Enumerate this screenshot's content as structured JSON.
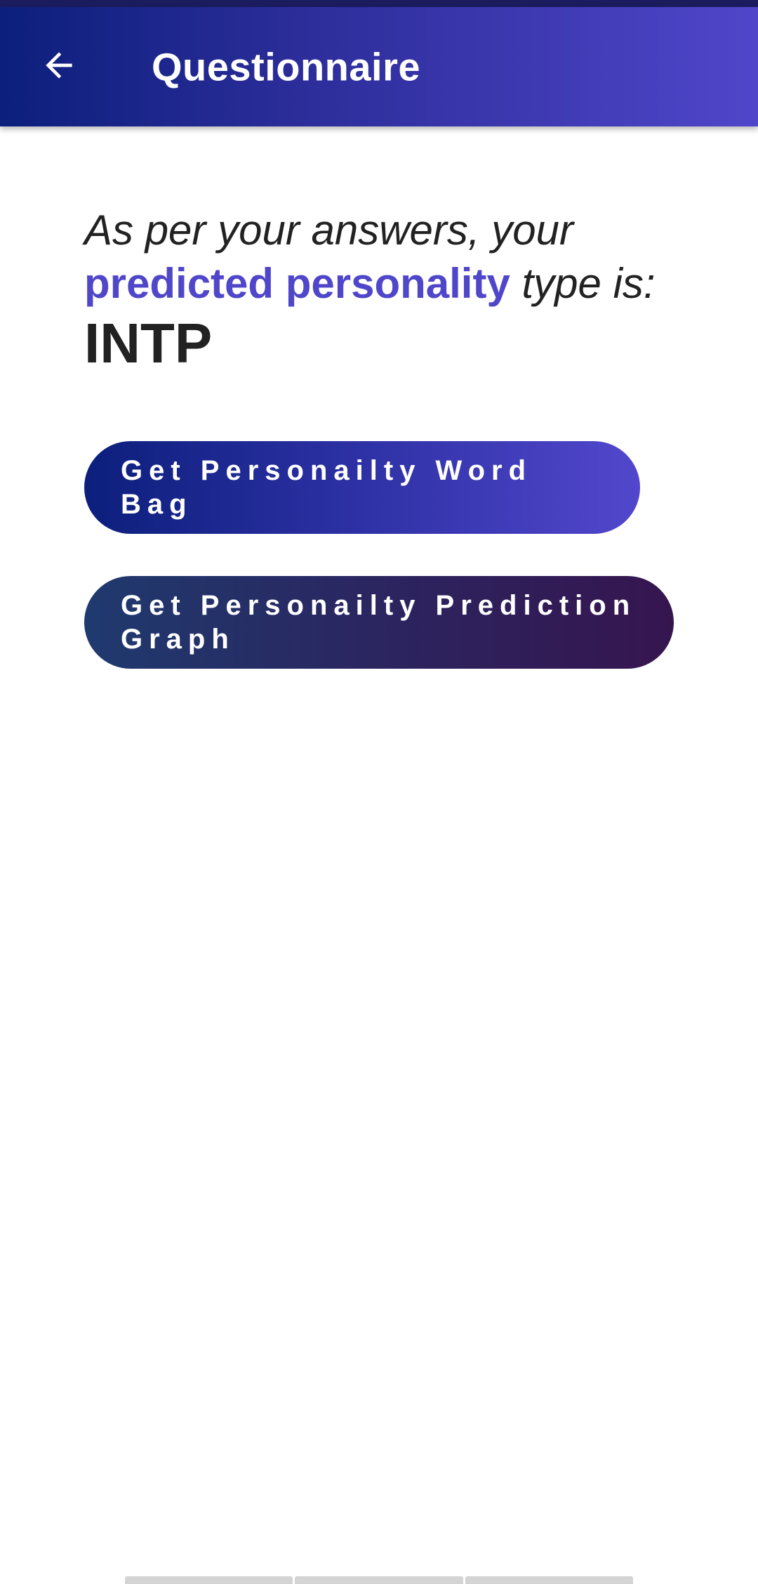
{
  "app_bar": {
    "title": "Questionnaire",
    "back_icon": "arrow-back-icon"
  },
  "result": {
    "prefix_text": "As per your answers, your",
    "highlight_text": "predicted personality",
    "suffix_text": "type is:",
    "personality_type": "INTP"
  },
  "buttons": {
    "word_bag_label": "Get Personailty Word Bag",
    "prediction_graph_label": "Get Personailty Prediction Graph"
  },
  "colors": {
    "accent": "#4f46c9",
    "app_bar_start": "#0c1f7c",
    "app_bar_end": "#4f46c9",
    "graph_button_start": "#1f3a6e",
    "graph_button_end": "#36154f"
  }
}
